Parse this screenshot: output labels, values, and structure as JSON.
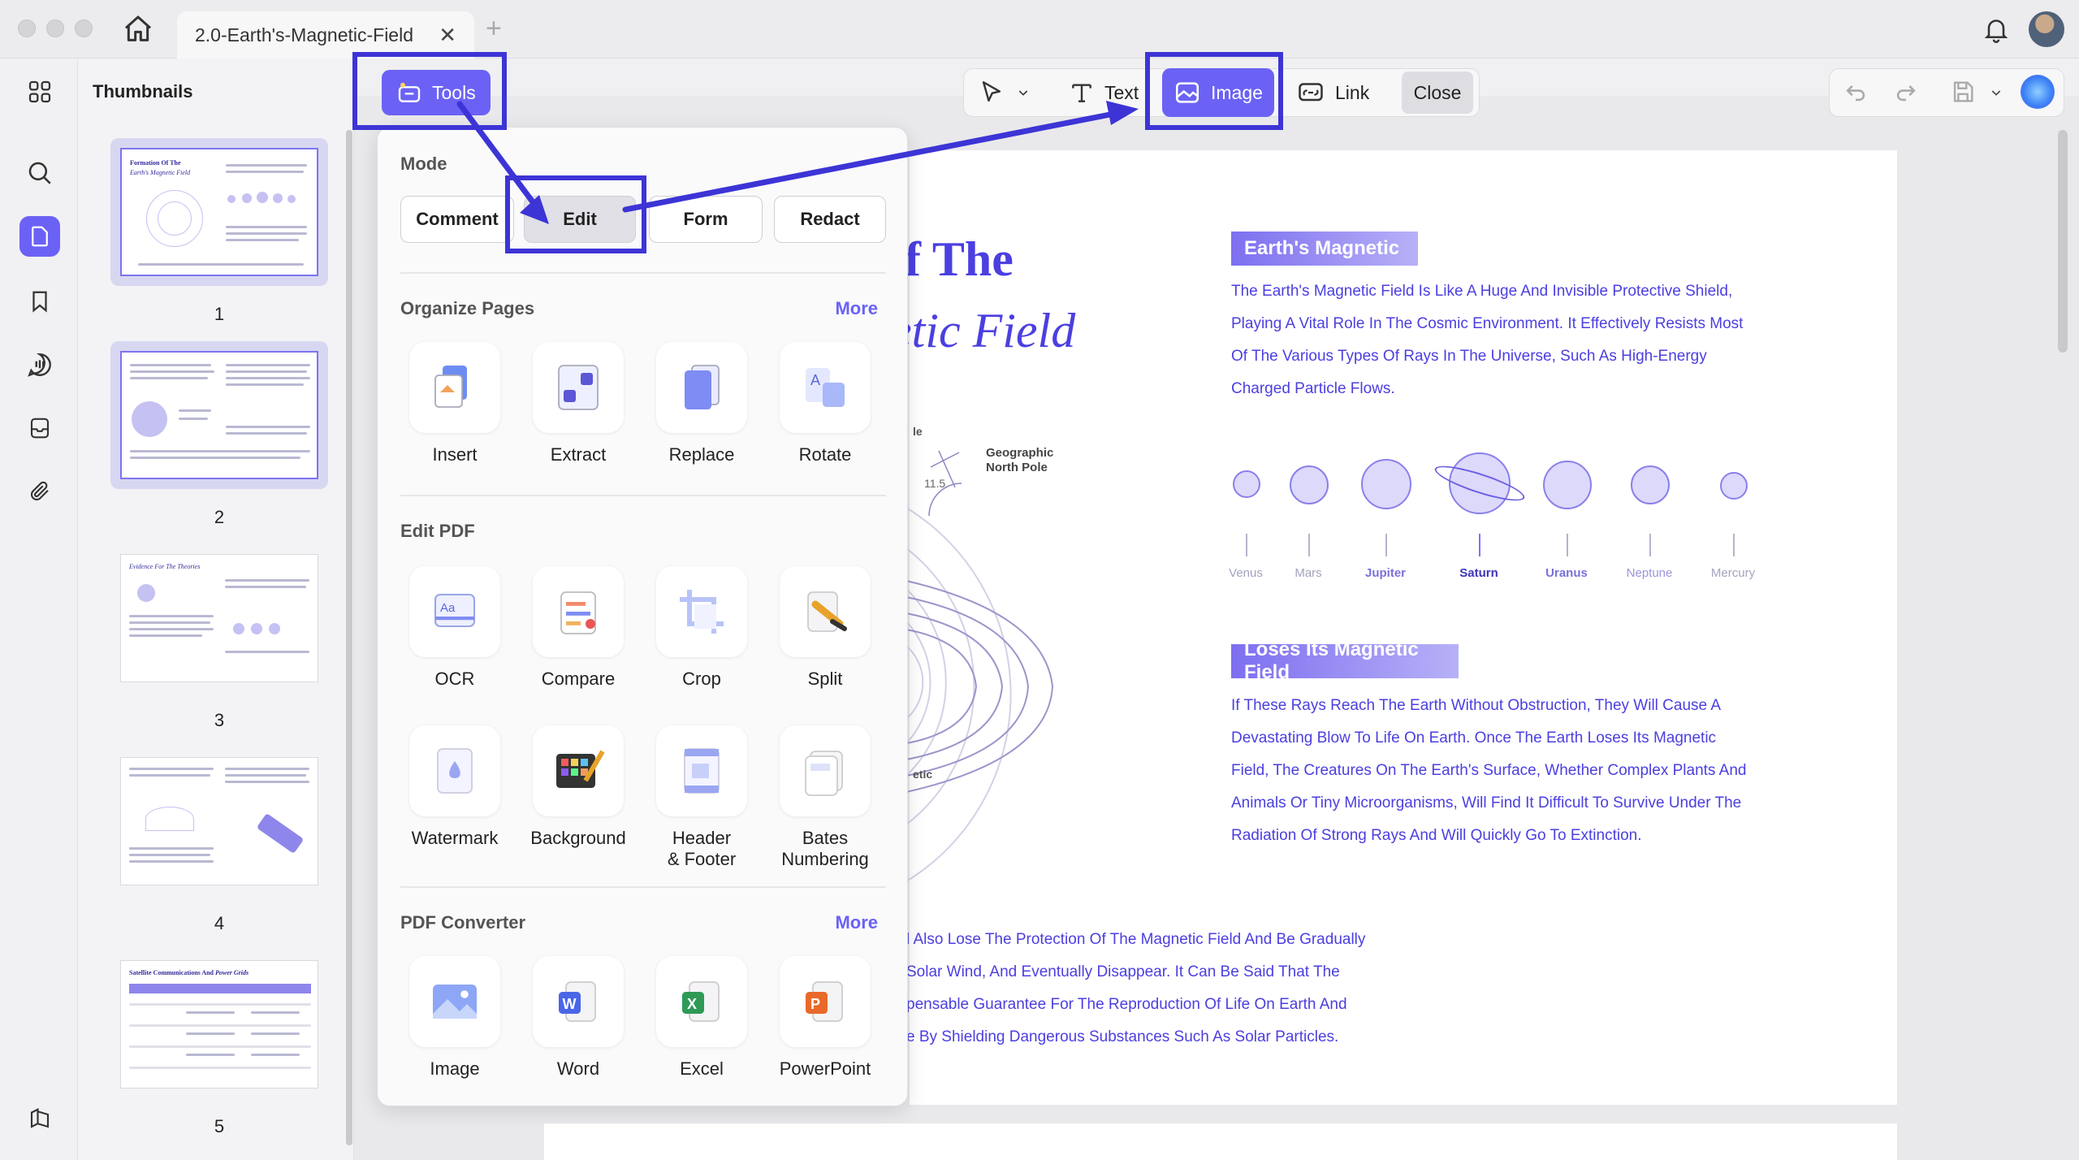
{
  "tab": {
    "title": "2.0-Earth's-Magnetic-Field"
  },
  "sidebar": {
    "title": "Thumbnails",
    "pages": [
      "1",
      "2",
      "3",
      "4",
      "5"
    ]
  },
  "toolbar": {
    "tools": "Tools",
    "text": "Text",
    "image": "Image",
    "link": "Link",
    "close": "Close"
  },
  "panel": {
    "mode_title": "Mode",
    "modes": [
      "Comment",
      "Edit",
      "Form",
      "Redact"
    ],
    "organize_title": "Organize Pages",
    "organize_more": "More",
    "organize": [
      "Insert",
      "Extract",
      "Replace",
      "Rotate"
    ],
    "edit_title": "Edit PDF",
    "edit": [
      "OCR",
      "Compare",
      "Crop",
      "Split",
      "Watermark",
      "Background",
      "Header\n& Footer",
      "Bates\nNumbering"
    ],
    "converter_title": "PDF Converter",
    "converter_more": "More",
    "converter": [
      "Image",
      "Word",
      "Excel",
      "PowerPoint"
    ]
  },
  "thumb_snippets": {
    "p1_title_1": "Formation Of The",
    "p1_title_2": "Earth's Magnetic Field",
    "p3_title": "Evidence For The Theories",
    "p5_title_1": "Satellite Communications And",
    "p5_title_2": "Power Grids"
  },
  "document": {
    "title_1": "f The",
    "title_2": "etic Field",
    "frag_le": "le",
    "frag_tic": "etic",
    "pole": "Geographic\nNorth Pole",
    "angle": "11.5",
    "banner_1": "Earth's Magnetic",
    "para_1": [
      "The Earth's Magnetic Field Is Like A Huge And Invisible Protective Shield,",
      "Playing A Vital Role In The Cosmic Environment. It Effectively Resists Most",
      "Of The Various Types Of Rays In The Universe, Such As High-Energy",
      "Charged Particle Flows."
    ],
    "planets": [
      "Venus",
      "Mars",
      "Jupiter",
      "Saturn",
      "Uranus",
      "Neptune",
      "Mercury"
    ],
    "banner_2": "Loses Its Magnetic Field",
    "para_2": [
      "If These Rays Reach The Earth Without Obstruction, They Will Cause A",
      "Devastating Blow To Life On Earth. Once The Earth Loses Its Magnetic",
      "Field, The Creatures On The Earth's Surface, Whether Complex Plants And",
      "Animals Or Tiny Microorganisms, Will Find It Difficult To Survive Under The",
      "Radiation Of Strong Rays And Will Quickly Go To Extinction."
    ],
    "para_3": [
      "l Also Lose The Protection Of The Magnetic Field And Be Gradually",
      "Solar Wind, And Eventually Disappear. It Can Be Said That The",
      "pensable Guarantee For The Reproduction Of Life On Earth And",
      "e By Shielding Dangerous Substances Such As Solar Particles."
    ]
  },
  "colors": {
    "accent": "#6b62f5",
    "annotation": "#3d34d6",
    "doc_text": "#4b3fe0"
  }
}
